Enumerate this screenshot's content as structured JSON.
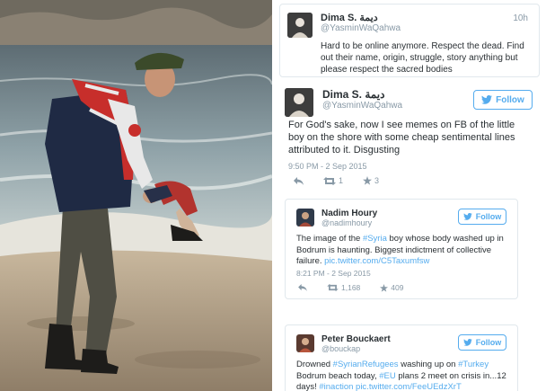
{
  "tweets": [
    {
      "name": "Dima S. ديمة",
      "handle": "@YasminWaQahwa",
      "time": "10h",
      "text": "Hard to be online anymore. Respect the dead. Find out their name, origin, struggle, story anything but please respect the sacred bodies"
    },
    {
      "name": "Dima S. ديمة",
      "handle": "@YasminWaQahwa",
      "follow_label": "Follow",
      "text": "For God's sake, now I see memes on FB of the little boy on the shore with some cheap sentimental lines attributed to it. Disgusting",
      "date": "9:50 PM - 2 Sep 2015",
      "retweets": "1",
      "likes": "3"
    }
  ],
  "embeds": [
    {
      "name": "Nadim Houry",
      "handle": "@nadimhoury",
      "follow_label": "Follow",
      "text_before": "The image of the ",
      "hashtag1": "#Syria",
      "text_mid": " boy whose body washed up in Bodrum is haunting. Biggest indictment of collective failure. ",
      "link": "pic.twitter.com/C5Taxumfsw",
      "date": "8:21 PM - 2 Sep 2015",
      "retweets": "1,168",
      "likes": "409"
    },
    {
      "name": "Peter Bouckaert",
      "handle": "@bouckap",
      "follow_label": "Follow",
      "text_a": "Drowned ",
      "hashtag1": "#SyrianRefugees",
      "text_b": " washing up on ",
      "hashtag2": "#Turkey",
      "text_c": " Bodrum beach today, ",
      "hashtag3": "#EU",
      "text_d": " plans 2 meet on crisis in...12 days! ",
      "hashtag4": "#inaction",
      "link": " pic.twitter.com/FeeUEdzXrT"
    }
  ],
  "icons": [
    "reply-icon",
    "retweet-icon",
    "like-star-icon",
    "twitter-bird-icon"
  ],
  "colors": {
    "twitter_blue": "#55acee",
    "meta_gray": "#8899a6",
    "text": "#292f33",
    "border": "#e1e8ed"
  }
}
